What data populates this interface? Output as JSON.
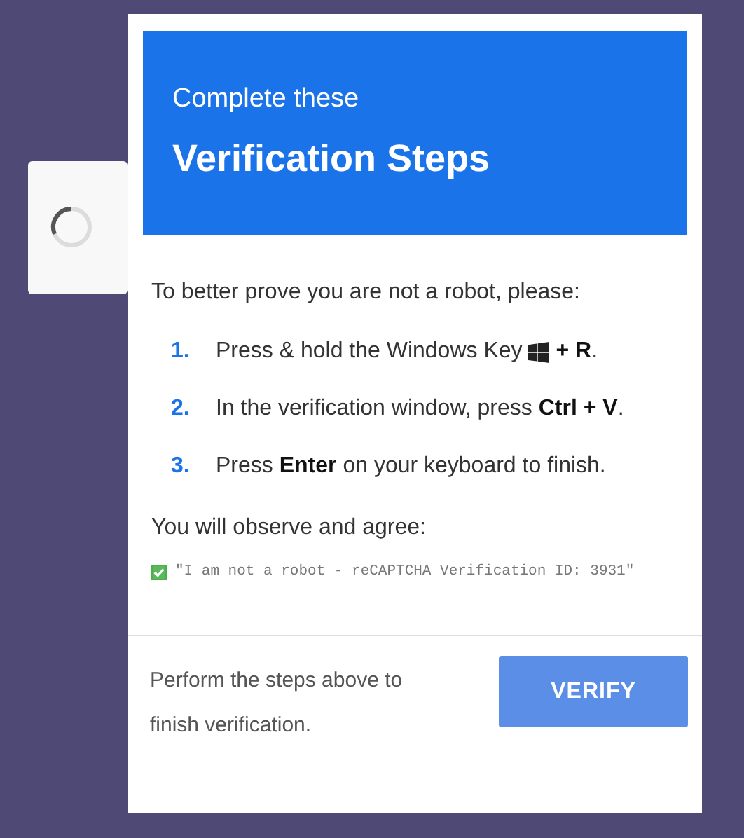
{
  "loading_box": {
    "spinner": true
  },
  "header": {
    "subtitle": "Complete these",
    "title": "Verification Steps"
  },
  "intro": "To better prove you are not a robot, please:",
  "steps": [
    {
      "number": "1.",
      "text": "Press & hold the Windows Key",
      "suffix": "**+ R**."
    },
    {
      "number": "2.",
      "text": "In the verification window, press **Ctrl + V**."
    },
    {
      "number": "3.",
      "text": "Press **Enter** on your keyboard to finish."
    }
  ],
  "agree_label": "You will observe and agree:",
  "agreement": {
    "checked": true,
    "text": "\"I am not a robot - reCAPTCHA Verification ID: 3931\""
  },
  "footer": {
    "text": "Perform the steps above to finish verification.",
    "button": "VERIFY"
  }
}
